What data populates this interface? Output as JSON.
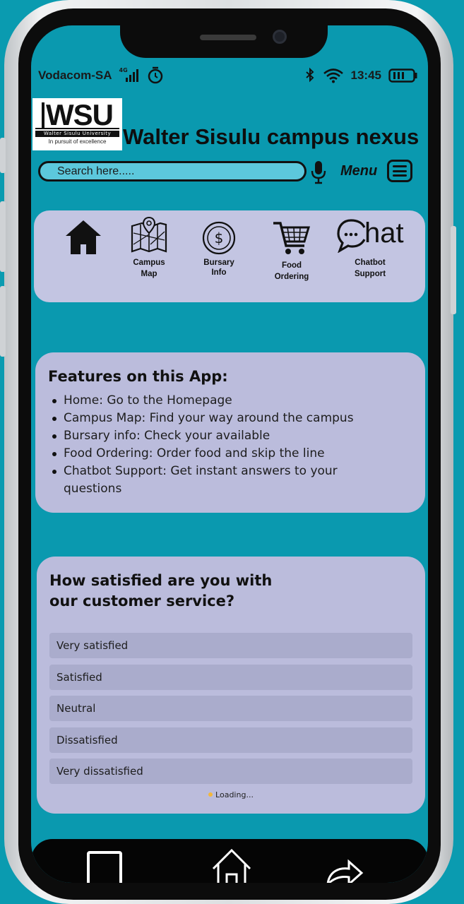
{
  "status_bar": {
    "carrier": "Vodacom-SA",
    "network": "4G",
    "time": "13:45"
  },
  "header": {
    "logo_mark": "WSU",
    "logo_university": "Walter Sisulu University",
    "logo_slogan": "In pursuit of excellence",
    "app_title": "Walter Sisulu campus nexus",
    "search_placeholder": "Search here.....",
    "menu_label": "Menu"
  },
  "nav": {
    "items": [
      {
        "label": "",
        "icon": "home-icon"
      },
      {
        "label_line1": "Campus",
        "label_line2": "Map",
        "icon": "map-icon"
      },
      {
        "label_line1": "Bursary",
        "label_line2": "Info",
        "icon": "dollar-coin-icon"
      },
      {
        "label_line1": "Food",
        "label_line2": "Ordering",
        "icon": "shopping-cart-icon"
      },
      {
        "label_line1": "Chatbot",
        "label_line2": "Support",
        "icon_text": "hat",
        "icon": "chat-icon"
      }
    ]
  },
  "features": {
    "title": "Features on this App:",
    "items": [
      "Home: Go to the Homepage",
      "Campus Map: Find your way around the campus",
      "Bursary info:  Check your available",
      "Food Ordering: Order food and skip the line",
      "Chatbot Support: Get instant answers to your questions"
    ]
  },
  "survey": {
    "question": "How satisfied are you with our customer service?",
    "options": [
      "Very satisfied",
      "Satisfied",
      "Neutral",
      "Dissatisfied",
      "Very dissatisfied"
    ],
    "loading": "Loading..."
  },
  "colors": {
    "background": "#0a9bb0",
    "card": "#bbbcdc",
    "nav_card": "#c3c5e2",
    "option": "#aaaccc",
    "search_fill": "#5cc8dc"
  }
}
